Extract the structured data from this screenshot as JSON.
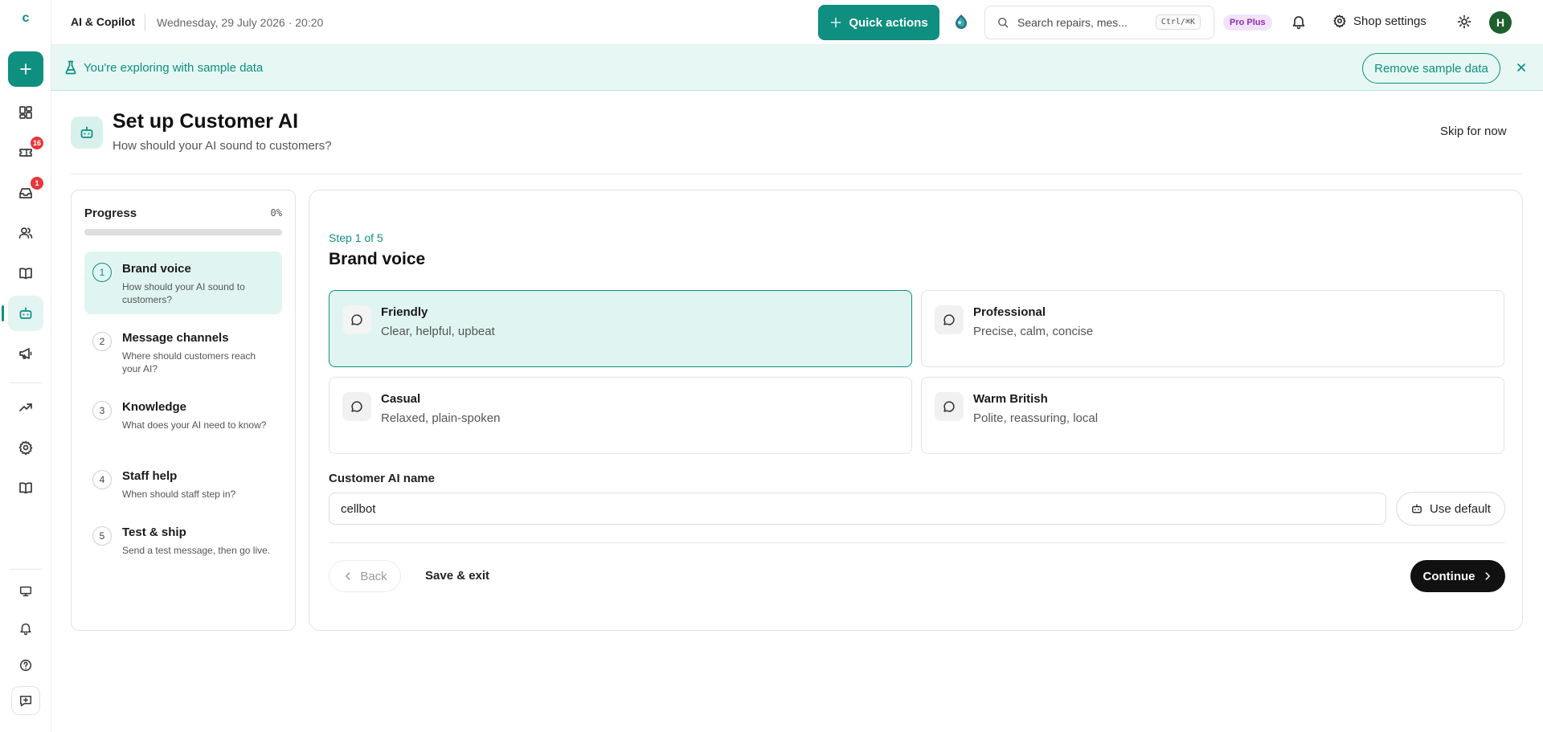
{
  "app": {
    "logo_letter": "c"
  },
  "sidebar": {
    "badges": {
      "tickets": "16",
      "inbox": "1"
    }
  },
  "topbar": {
    "breadcrumb": "AI & Copilot",
    "datetime": "Wednesday, 29 July 2026 · 20:20",
    "quick_actions_label": "Quick actions",
    "search_placeholder": "Search repairs, mes...",
    "search_shortcut": "Ctrl/⌘K",
    "plan_badge": "Pro Plus",
    "shop_settings_label": "Shop settings",
    "avatar_initial": "H"
  },
  "banner": {
    "text": "You're exploring with sample data",
    "remove_label": "Remove sample data"
  },
  "page": {
    "title": "Set up Customer AI",
    "subtitle": "How should your AI sound to customers?",
    "skip_label": "Skip for now"
  },
  "progress": {
    "title": "Progress",
    "percent_label": "0%",
    "percent_value": 0,
    "steps": [
      {
        "num": "1",
        "title": "Brand voice",
        "desc": "How should your AI sound to customers?",
        "active": true
      },
      {
        "num": "2",
        "title": "Message channels",
        "desc": "Where should customers reach your AI?",
        "active": false
      },
      {
        "num": "3",
        "title": "Knowledge",
        "desc": "What does your AI need to know?",
        "active": false
      },
      {
        "num": "4",
        "title": "Staff help",
        "desc": "When should staff step in?",
        "active": false
      },
      {
        "num": "5",
        "title": "Test & ship",
        "desc": "Send a test message, then go live.",
        "active": false
      }
    ]
  },
  "wizard": {
    "step_label": "Step 1 of 5",
    "heading": "Brand voice",
    "options": [
      {
        "title": "Friendly",
        "desc": "Clear, helpful, upbeat",
        "selected": true
      },
      {
        "title": "Professional",
        "desc": "Precise, calm, concise",
        "selected": false
      },
      {
        "title": "Casual",
        "desc": "Relaxed, plain-spoken",
        "selected": false
      },
      {
        "title": "Warm British",
        "desc": "Polite, reassuring, local",
        "selected": false
      }
    ],
    "name_label": "Customer AI name",
    "name_value": "cellbot",
    "use_default_label": "Use default",
    "back_label": "Back",
    "save_exit_label": "Save & exit",
    "continue_label": "Continue"
  },
  "colors": {
    "accent": "#0e8f80",
    "accent_light": "#e0f5f1",
    "badge_red": "#e5383b",
    "plan_purple": "#8a2fb0"
  }
}
